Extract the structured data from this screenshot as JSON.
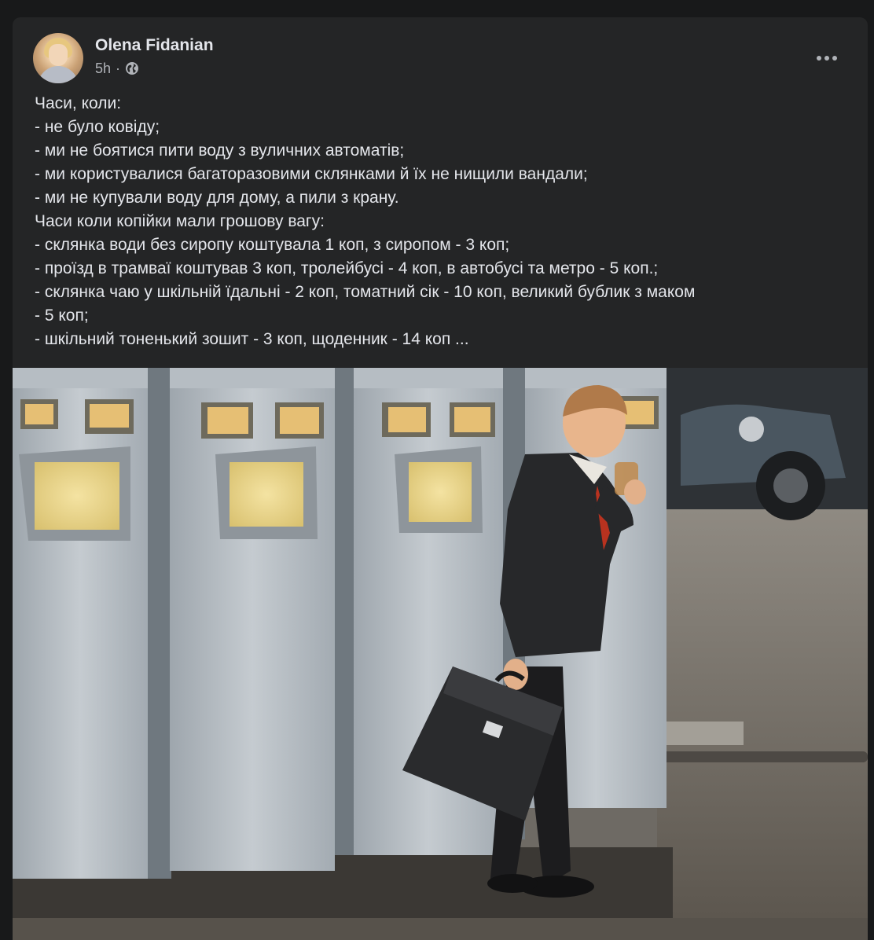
{
  "post": {
    "author": "Olena Fidanian",
    "time": "5h",
    "separator": "·",
    "privacy_icon": "globe-icon",
    "more_icon": "more-horizontal-icon",
    "lines": [
      "Часи, коли:",
      "- не було ковіду;",
      "- ми не боятися пити воду з вуличних автоматів;",
      "- ми користувалися багаторазовими склянками й їх не нищили вандали;",
      "- ми не купували воду для дому, а пили з крану.",
      "Часи коли копійки мали грошову вагу:",
      "- склянка води без сиропу коштувала 1 коп, з сиропом - 3 коп;",
      "- проїзд в трамваї коштував 3 коп, тролейбусі - 4 коп, в автобусі та метро - 5 коп.;",
      "- склянка чаю у шкільній їдальні - 2 коп, томатний сік - 10 коп, великий бублик з маком",
      "- 5 коп;",
      "- шкільний тоненький зошит - 3 коп, щоденник - 14 коп ..."
    ]
  },
  "colors": {
    "page_bg": "#18191a",
    "card_bg": "#242526",
    "primary_text": "#e4e6eb",
    "secondary_text": "#b0b3b8"
  }
}
